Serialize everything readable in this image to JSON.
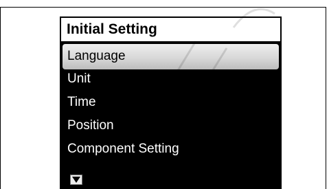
{
  "screen": {
    "title": "Initial Setting",
    "selected_index": 0,
    "menu_items": [
      {
        "label": "Language",
        "selected": true
      },
      {
        "label": "Unit",
        "selected": false
      },
      {
        "label": "Time",
        "selected": false
      },
      {
        "label": "Position",
        "selected": false
      },
      {
        "label": "Component Setting",
        "selected": false
      }
    ],
    "scroll_indicator": "triangle-down-icon"
  },
  "colors": {
    "screen_background": "#000000",
    "title_background": "#ffffff",
    "item_text": "#ffffff",
    "selected_text": "#000000",
    "selected_highlight": "#d8d8d8"
  }
}
